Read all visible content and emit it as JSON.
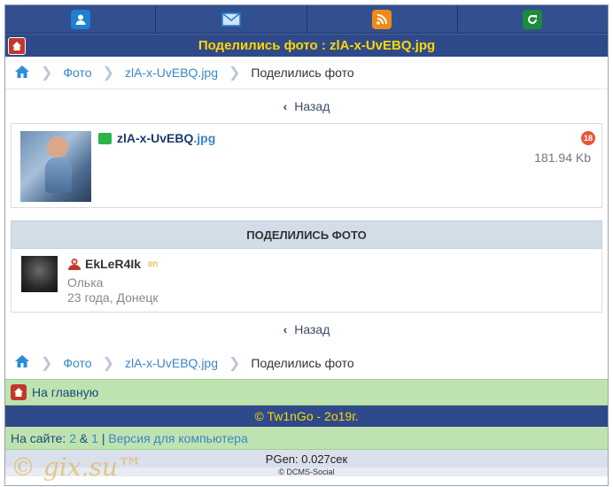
{
  "topnav": {
    "items": [
      {
        "icon": "user-icon",
        "color": "#1f7fd1"
      },
      {
        "icon": "mail-icon",
        "color": "#1f7fd1"
      },
      {
        "icon": "rss-icon",
        "color": "#f08a1b"
      },
      {
        "icon": "refresh-icon",
        "color": "#1e8a3c"
      }
    ]
  },
  "page_title": "Поделились фото : zlA-x-UvEBQ.jpg",
  "breadcrumb": {
    "items": [
      "Фото",
      "zlA-x-UvEBQ.jpg"
    ],
    "current": "Поделились фото"
  },
  "back_label": "Назад",
  "file": {
    "name": "zlA-x-UvEBQ",
    "ext": " .jpg",
    "age_badge": "18",
    "size": "181.94 Kb"
  },
  "section_title": "ПОДЕЛИЛИСЬ ФОТО",
  "user": {
    "name": "EkLeR4Ik",
    "status": "on",
    "real_name": "Олька",
    "info": "23 года, Донецк"
  },
  "home_link": "На главную",
  "copyright": "© Tw1nGo - 2o19г.",
  "online": {
    "label": "На сайте:",
    "count1": "2",
    "amp": "&",
    "count2": "1",
    "separator": "|",
    "desktop_link": "Версия для компьютера"
  },
  "pgen": "PGen: 0.027сек",
  "engine": "© DCMS-Social",
  "watermark": "© gix.su™",
  "colors": {
    "header_blue": "#2f4a8a",
    "title_yellow": "#ffd700",
    "link_blue": "#3a86c6",
    "green_bar": "#bfe3b0"
  }
}
